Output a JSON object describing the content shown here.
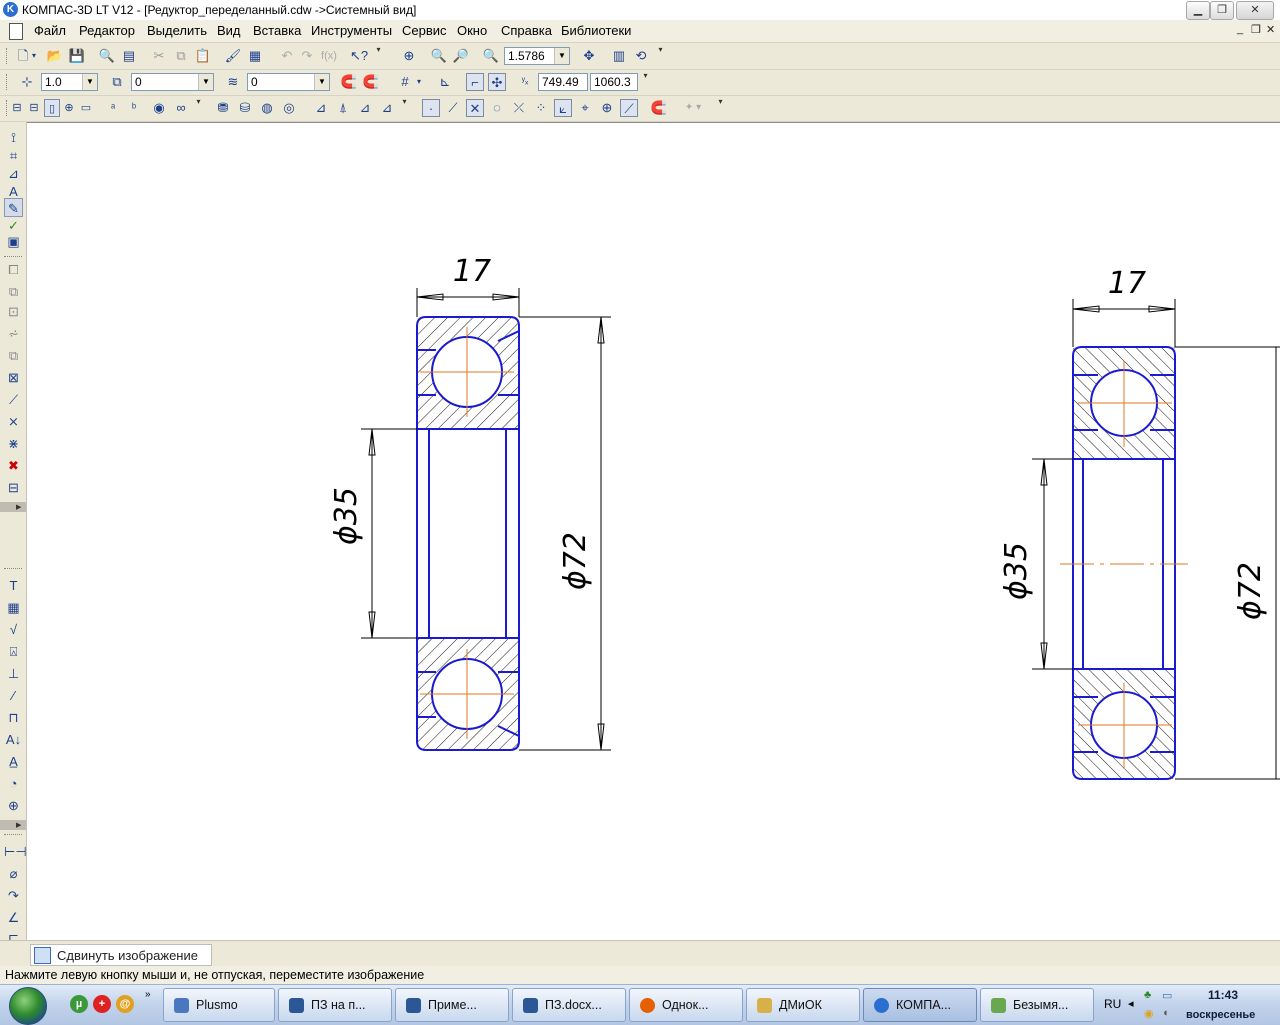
{
  "window": {
    "title": "КОМПАС-3D LT V12 - [Редуктор_переделанный.cdw ->Системный вид]",
    "app_icon": "K"
  },
  "menu": {
    "items": [
      "Файл",
      "Редактор",
      "Выделить",
      "Вид",
      "Вставка",
      "Инструменты",
      "Сервис",
      "Окно",
      "Справка",
      "Библиотеки"
    ]
  },
  "toolbar": {
    "zoom_value": "1.5786",
    "step_value": "1.0",
    "layer_value": "0",
    "style_value": "0",
    "coord_x": "749.49",
    "coord_y": "1060.3"
  },
  "drawing": {
    "bearing_left": {
      "width_label": "17",
      "inner_diameter_label": "ϕ35",
      "outer_diameter_label": "ϕ72"
    },
    "bearing_right": {
      "width_label": "17",
      "inner_diameter_label": "ϕ35",
      "outer_diameter_label": "ϕ72"
    },
    "outline_color": "#1a1ad0",
    "centerline_color": "#e07a1f",
    "dimension_color": "#000000"
  },
  "command_panel": {
    "tab_label": "Сдвинуть изображение"
  },
  "status": {
    "hint": "Нажмите левую кнопку мыши и, не отпуская, переместите изображение"
  },
  "taskbar": {
    "buttons": [
      {
        "label": "Plusmo",
        "icon": "plusmo-icon",
        "color": "#4a78c0"
      },
      {
        "label": "ПЗ на п...",
        "icon": "word-icon",
        "color": "#2b5797"
      },
      {
        "label": "Приме...",
        "icon": "word-icon",
        "color": "#2b5797"
      },
      {
        "label": "ПЗ.docx...",
        "icon": "word-icon",
        "color": "#2b5797"
      },
      {
        "label": "Однок...",
        "icon": "firefox-icon",
        "color": "#e66000"
      },
      {
        "label": "ДМиОК",
        "icon": "folder-icon",
        "color": "#d8b04a"
      },
      {
        "label": "КОМПА...",
        "icon": "kompas-icon",
        "color": "#2a6ed0"
      },
      {
        "label": "Безымя...",
        "icon": "paint-icon",
        "color": "#6aa84f"
      }
    ],
    "language": "RU",
    "time": "11:43",
    "day": "воскресенье"
  }
}
